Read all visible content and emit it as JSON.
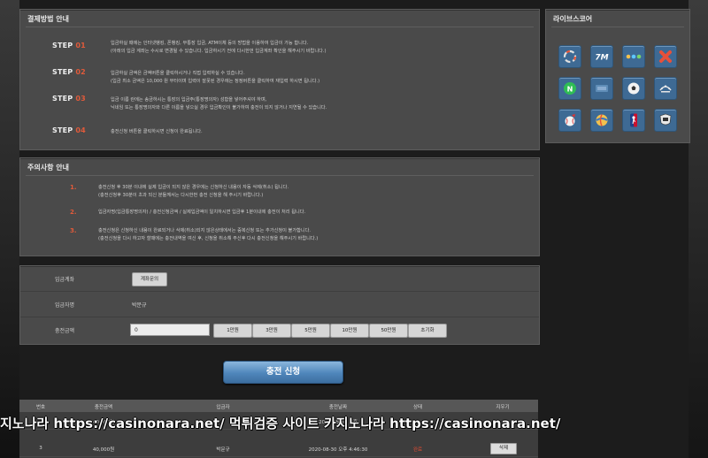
{
  "payment_guide": {
    "title": "결제방법 안내",
    "steps": [
      {
        "label": "STEP 01",
        "lines": [
          "입금하실 때에는 인터넷뱅킹, 폰뱅킹, 무통장 입금, ATM이체 등의 방법을 이용하여 입금이 가능 합니다.",
          "(아래의 입금 계좌는 수시로 변경될 수 있습니다. 입금하시기 전에 다시한번 입금계좌 확인을 해주시기 바랍니다.)"
        ]
      },
      {
        "label": "STEP 02",
        "lines": [
          "입금하실 금액은 금액버튼을 클릭하시거나 직접 입력하실 수 있습니다.",
          "(입금 최소 금액은 10,000 원 부터이며 입력이 잘못된 경우에는 정정버튼을 클릭하여 재입력 하시면 됩니다.)"
        ]
      },
      {
        "label": "STEP 03",
        "lines": [
          "입금 이름 란에는 송금하시는 통장의 입금주(통장명의자) 성함을 넣어주셔야 하며,",
          "닉네임 또는 통장명의자와 다른 이름을 넣으실 경우 입금확인이 불가하여 충전이 되지 않거나 지연될 수 있습니다."
        ]
      },
      {
        "label": "STEP 04",
        "lines": [
          "충전신청 버튼을 클릭하시면 신청이 완료됩니다."
        ]
      }
    ]
  },
  "caution": {
    "title": "주의사항 안내",
    "items": [
      {
        "num": "1.",
        "lines": [
          "충전신청 후 30분 이내에 실제 입금이 되지 않은 경우에는 신청하신 내용이 자동 삭제(취소) 됩니다.",
          "(충전신청후 30분이 초과 되신 분들께서는 다시한번 충전 신청을 해 주시기 바랍니다.)"
        ]
      },
      {
        "num": "2.",
        "lines": [
          "입금자명(입금통장명의자) / 충전신청금액 / 실제입금액이 일치하시면 입금후 1분이내에 충전이 처리 됩니다."
        ]
      },
      {
        "num": "3.",
        "lines": [
          "충전신청은 신청하신 내용이 완료되거나 삭제(취소)되지 않은상태에서는 중복신청 또는 추가신청이 불가합니다.",
          "(충전신청을 다시 하고자 할때에는 충전내역을 여신 후, 신청을 취소해 주신후 다시 충전신청을 해주시기 바랍니다.)"
        ]
      }
    ]
  },
  "form": {
    "account_label": "입금계좌",
    "account_button": "계좌문의",
    "depositor_label": "입금자명",
    "depositor_value": "박문규",
    "amount_label": "충전금액",
    "amount_value": "0",
    "amount_buttons": [
      "1만원",
      "3만원",
      "5만원",
      "10만원",
      "50만원",
      "초기화"
    ]
  },
  "submit_label": "충전 신청",
  "history": {
    "headers": [
      "번호",
      "충전금액",
      "입금자",
      "충전날짜",
      "상태",
      "지우기"
    ],
    "rows": [
      {
        "no": "",
        "amount": "40,000원",
        "depositor": "",
        "date": "2020-08-30 오후",
        "status": "",
        "action": ""
      },
      {
        "no": "3",
        "amount": "40,000원",
        "depositor": "박문규",
        "date": "2020-08-30 오후 4:46:30",
        "status": "완료",
        "action": "삭제"
      }
    ]
  },
  "watermark": "지노나라 https://casinonara.net/   먹튀검증 사이트 카지노나라 https://casinonara.net/",
  "live_score": {
    "title": "라이브스코어",
    "icons": [
      "livescore-icon",
      "7m-icon",
      "nowgoal-icon",
      "betman-icon",
      "naver-icon",
      "score-icon",
      "soccerball-icon",
      "uefa-icon",
      "baseball-icon",
      "volleyball-icon",
      "nba-icon",
      "nhl-icon"
    ],
    "icon_7m_text": "7M",
    "icon_n_text": "N"
  },
  "colors": {
    "accent_red": "#e05a3a",
    "button_blue": "#4f86bb",
    "tile_blue": "#3e6a94"
  }
}
